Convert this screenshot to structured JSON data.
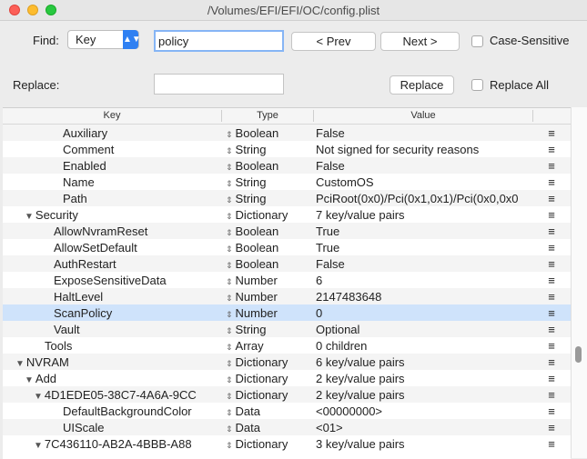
{
  "window": {
    "title": "/Volumes/EFI/EFI/OC/config.plist"
  },
  "find": {
    "find_label": "Find:",
    "field_type": "Key",
    "query": "policy",
    "prev_label": "< Prev",
    "next_label": "Next >",
    "case_sensitive_label": "Case-Sensitive",
    "replace_label": "Replace:",
    "replace_value": "",
    "replace_button": "Replace",
    "replace_all_label": "Replace All"
  },
  "table": {
    "headers": {
      "key": "Key",
      "type": "Type",
      "value": "Value"
    },
    "rows": [
      {
        "key": "Auxiliary",
        "indent": 5,
        "disclosure": "",
        "type": "Boolean",
        "value": "False"
      },
      {
        "key": "Comment",
        "indent": 5,
        "disclosure": "",
        "type": "String",
        "value": "Not signed for security reasons"
      },
      {
        "key": "Enabled",
        "indent": 5,
        "disclosure": "",
        "type": "Boolean",
        "value": "False"
      },
      {
        "key": "Name",
        "indent": 5,
        "disclosure": "",
        "type": "String",
        "value": "CustomOS"
      },
      {
        "key": "Path",
        "indent": 5,
        "disclosure": "",
        "type": "String",
        "value": "PciRoot(0x0)/Pci(0x1,0x1)/Pci(0x0,0x0"
      },
      {
        "key": "Security",
        "indent": 2,
        "disclosure": "▼",
        "type": "Dictionary",
        "value": "7 key/value pairs"
      },
      {
        "key": "AllowNvramReset",
        "indent": 4,
        "disclosure": "",
        "type": "Boolean",
        "value": "True"
      },
      {
        "key": "AllowSetDefault",
        "indent": 4,
        "disclosure": "",
        "type": "Boolean",
        "value": "True"
      },
      {
        "key": "AuthRestart",
        "indent": 4,
        "disclosure": "",
        "type": "Boolean",
        "value": "False"
      },
      {
        "key": "ExposeSensitiveData",
        "indent": 4,
        "disclosure": "",
        "type": "Number",
        "value": "6"
      },
      {
        "key": "HaltLevel",
        "indent": 4,
        "disclosure": "",
        "type": "Number",
        "value": "2147483648"
      },
      {
        "key": "ScanPolicy",
        "indent": 4,
        "disclosure": "",
        "type": "Number",
        "value": "0",
        "selected": true
      },
      {
        "key": "Vault",
        "indent": 4,
        "disclosure": "",
        "type": "String",
        "value": "Optional"
      },
      {
        "key": "Tools",
        "indent": 3,
        "disclosure": "",
        "type": "Array",
        "value": "0 children"
      },
      {
        "key": "NVRAM",
        "indent": 1,
        "disclosure": "▼",
        "type": "Dictionary",
        "value": "6 key/value pairs"
      },
      {
        "key": "Add",
        "indent": 2,
        "disclosure": "▼",
        "type": "Dictionary",
        "value": "2 key/value pairs"
      },
      {
        "key": "4D1EDE05-38C7-4A6A-9CC",
        "indent": 3,
        "disclosure": "▼",
        "type": "Dictionary",
        "value": "2 key/value pairs"
      },
      {
        "key": "DefaultBackgroundColor",
        "indent": 5,
        "disclosure": "",
        "type": "Data",
        "value": "<00000000>"
      },
      {
        "key": "UIScale",
        "indent": 5,
        "disclosure": "",
        "type": "Data",
        "value": "<01>"
      },
      {
        "key": "7C436110-AB2A-4BBB-A88",
        "indent": 3,
        "disclosure": "▼",
        "type": "Dictionary",
        "value": "3 key/value pairs"
      }
    ]
  },
  "icons": {
    "type_arrows": "⇕",
    "row_menu": "≡",
    "select_chevron": "⌄"
  },
  "colors": {
    "selection": "#cfe3fb",
    "accent": "#2f80f2",
    "focus_ring": "#86b5f5"
  }
}
